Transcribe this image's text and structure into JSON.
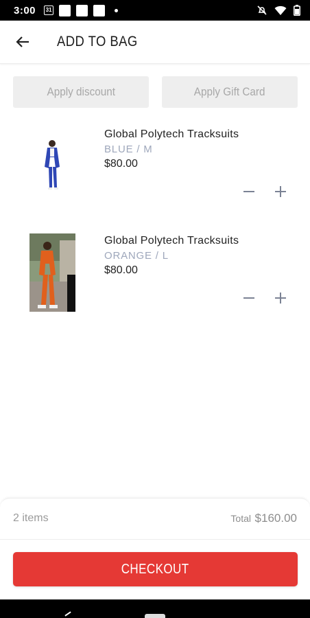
{
  "status_bar": {
    "time": "3:00",
    "calendar_day": "31"
  },
  "header": {
    "title": "ADD TO BAG"
  },
  "promo": {
    "discount_label": "Apply discount",
    "gift_card_label": "Apply Gift Card"
  },
  "cart": {
    "items": [
      {
        "name": "Global Polytech Tracksuits",
        "variant": "BLUE / M",
        "price": "$80.00",
        "color": "#2f47b5"
      },
      {
        "name": "Global Polytech Tracksuits",
        "variant": "ORANGE / L",
        "price": "$80.00",
        "color": "#e0601d"
      }
    ]
  },
  "summary": {
    "count": "2 items",
    "total_label": "Total",
    "total_value": "$160.00"
  },
  "checkout": {
    "label": "CHECKOUT"
  },
  "colors": {
    "accent": "#e53935",
    "muted_text": "#9ea7bb",
    "promo_bg": "#eeeeee"
  }
}
